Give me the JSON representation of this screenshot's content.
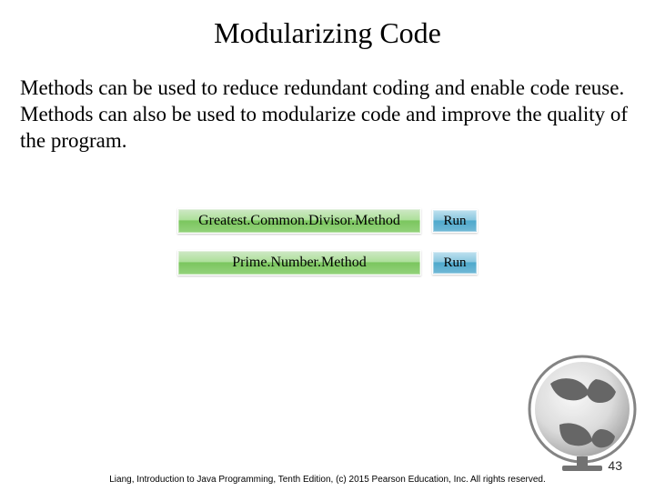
{
  "title": "Modularizing Code",
  "body": "Methods can be used to reduce redundant coding and enable code reuse. Methods can also be used to modularize code and improve the quality of the program.",
  "buttons": [
    {
      "code_label": "Greatest.Common.Divisor.Method",
      "run_label": "Run"
    },
    {
      "code_label": "Prime.Number.Method",
      "run_label": "Run"
    }
  ],
  "footer": "Liang, Introduction to Java Programming, Tenth Edition, (c) 2015 Pearson Education, Inc. All rights reserved.",
  "page_number": "43"
}
